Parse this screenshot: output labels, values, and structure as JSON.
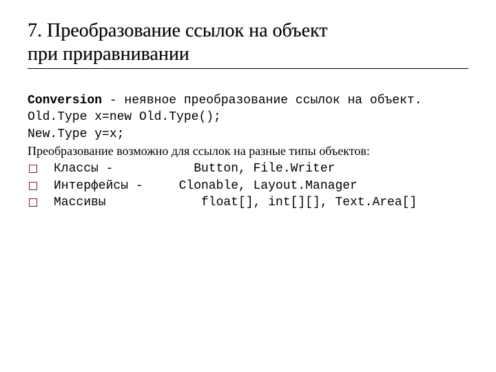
{
  "title": {
    "line1": "7. Преобразование ссылок на объект",
    "line2": " при приравнивании"
  },
  "content": {
    "conversion_label": "Conversion",
    "conversion_rest": " - неявное преобразование ссылок на объект.",
    "code1": "Old.Type x=new Old.Type();",
    "code2": "New.Type y=x;",
    "intro": "Преобразование возможно для ссылок на разные типы объектов:"
  },
  "bullets": [
    {
      "label": "Классы -",
      "value": "    Button, File.Writer"
    },
    {
      "label": "Интерфейсы -",
      "value": "  Clonable, Layout.Manager"
    },
    {
      "label": "Массивы",
      "value": "     float[], int[][], Text.Area[]"
    }
  ]
}
